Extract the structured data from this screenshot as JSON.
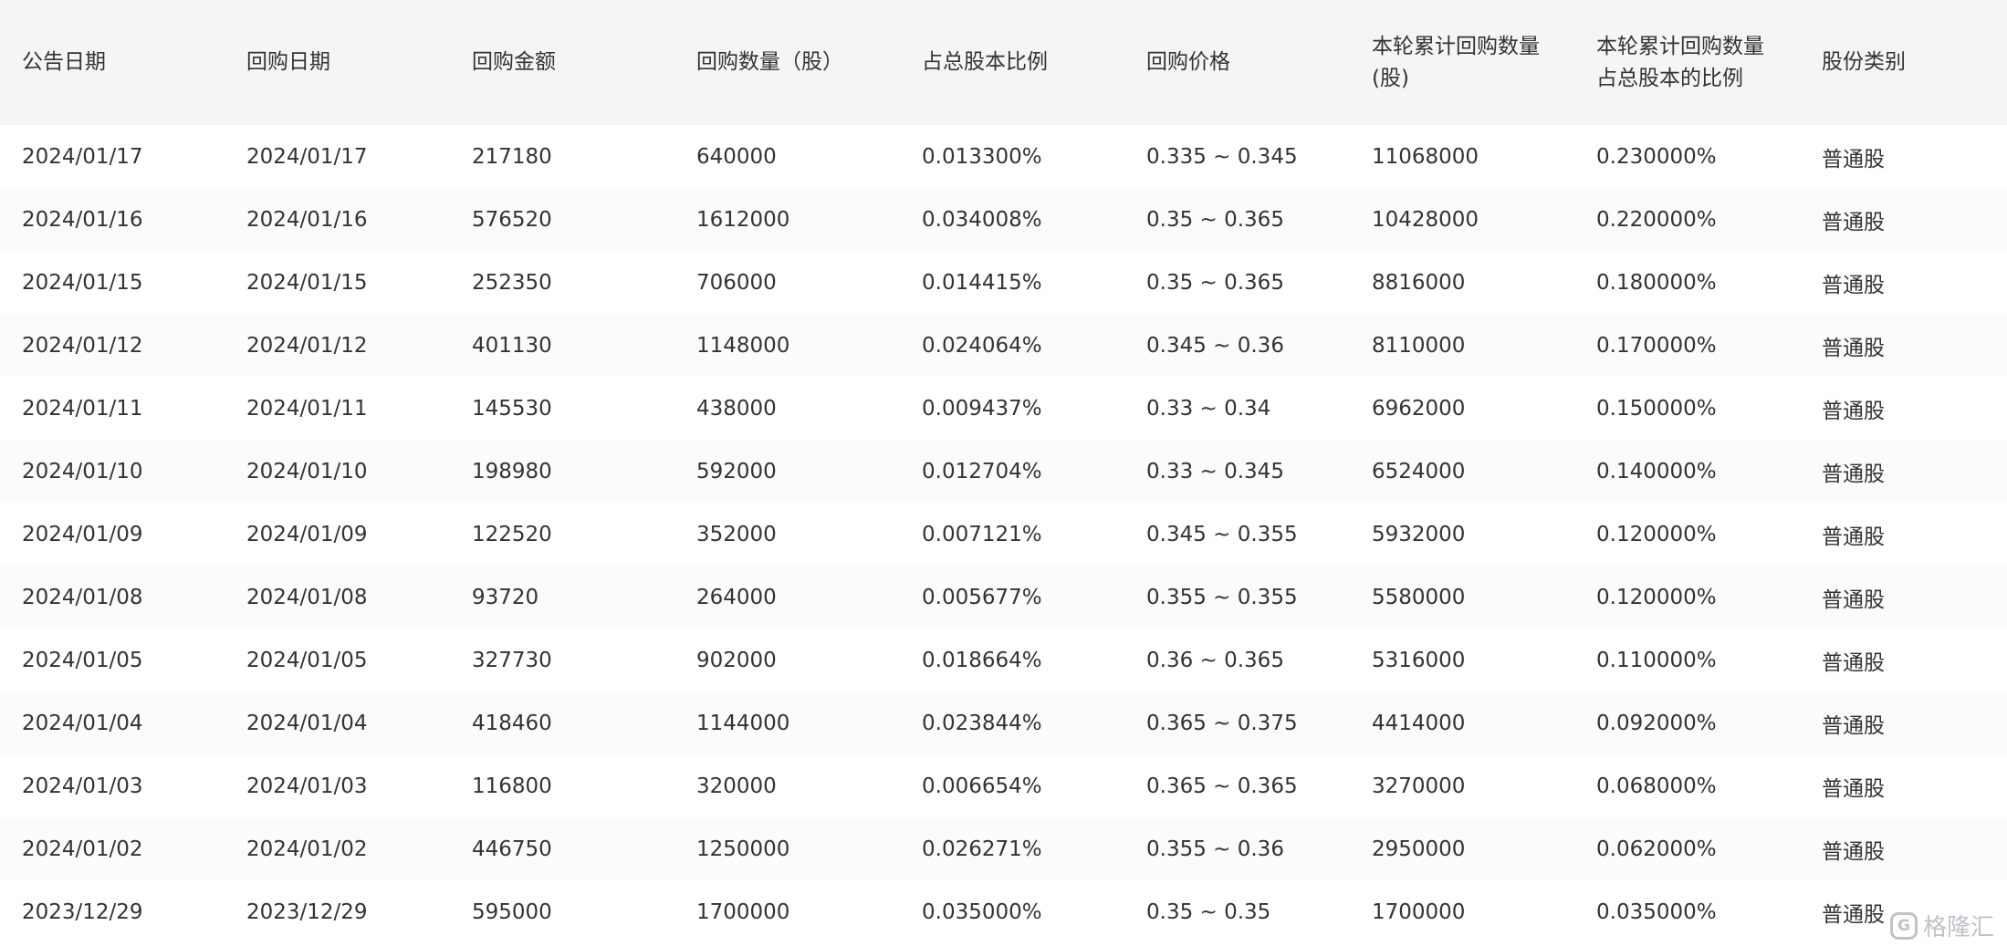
{
  "table": {
    "headers": [
      "公告日期",
      "回购日期",
      "回购金额",
      "回购数量（股）",
      "占总股本比例",
      "回购价格",
      "本轮累计回购数量(股)",
      "本轮累计回购数量占总股本的比例",
      "股份类别"
    ],
    "rows": [
      [
        "2024/01/17",
        "2024/01/17",
        "217180",
        "640000",
        "0.013300%",
        "0.335 ~ 0.345",
        "11068000",
        "0.230000%",
        "普通股"
      ],
      [
        "2024/01/16",
        "2024/01/16",
        "576520",
        "1612000",
        "0.034008%",
        "0.35 ~ 0.365",
        "10428000",
        "0.220000%",
        "普通股"
      ],
      [
        "2024/01/15",
        "2024/01/15",
        "252350",
        "706000",
        "0.014415%",
        "0.35 ~ 0.365",
        "8816000",
        "0.180000%",
        "普通股"
      ],
      [
        "2024/01/12",
        "2024/01/12",
        "401130",
        "1148000",
        "0.024064%",
        "0.345 ~ 0.36",
        "8110000",
        "0.170000%",
        "普通股"
      ],
      [
        "2024/01/11",
        "2024/01/11",
        "145530",
        "438000",
        "0.009437%",
        "0.33 ~ 0.34",
        "6962000",
        "0.150000%",
        "普通股"
      ],
      [
        "2024/01/10",
        "2024/01/10",
        "198980",
        "592000",
        "0.012704%",
        "0.33 ~ 0.345",
        "6524000",
        "0.140000%",
        "普通股"
      ],
      [
        "2024/01/09",
        "2024/01/09",
        "122520",
        "352000",
        "0.007121%",
        "0.345 ~ 0.355",
        "5932000",
        "0.120000%",
        "普通股"
      ],
      [
        "2024/01/08",
        "2024/01/08",
        "93720",
        "264000",
        "0.005677%",
        "0.355 ~ 0.355",
        "5580000",
        "0.120000%",
        "普通股"
      ],
      [
        "2024/01/05",
        "2024/01/05",
        "327730",
        "902000",
        "0.018664%",
        "0.36 ~ 0.365",
        "5316000",
        "0.110000%",
        "普通股"
      ],
      [
        "2024/01/04",
        "2024/01/04",
        "418460",
        "1144000",
        "0.023844%",
        "0.365 ~ 0.375",
        "4414000",
        "0.092000%",
        "普通股"
      ],
      [
        "2024/01/03",
        "2024/01/03",
        "116800",
        "320000",
        "0.006654%",
        "0.365 ~ 0.365",
        "3270000",
        "0.068000%",
        "普通股"
      ],
      [
        "2024/01/02",
        "2024/01/02",
        "446750",
        "1250000",
        "0.026271%",
        "0.355 ~ 0.36",
        "2950000",
        "0.062000%",
        "普通股"
      ],
      [
        "2023/12/29",
        "2023/12/29",
        "595000",
        "1700000",
        "0.035000%",
        "0.35 ~ 0.35",
        "1700000",
        "0.035000%",
        "普通股"
      ]
    ]
  },
  "watermark": {
    "logo_letter": "G",
    "text": "格隆汇"
  }
}
